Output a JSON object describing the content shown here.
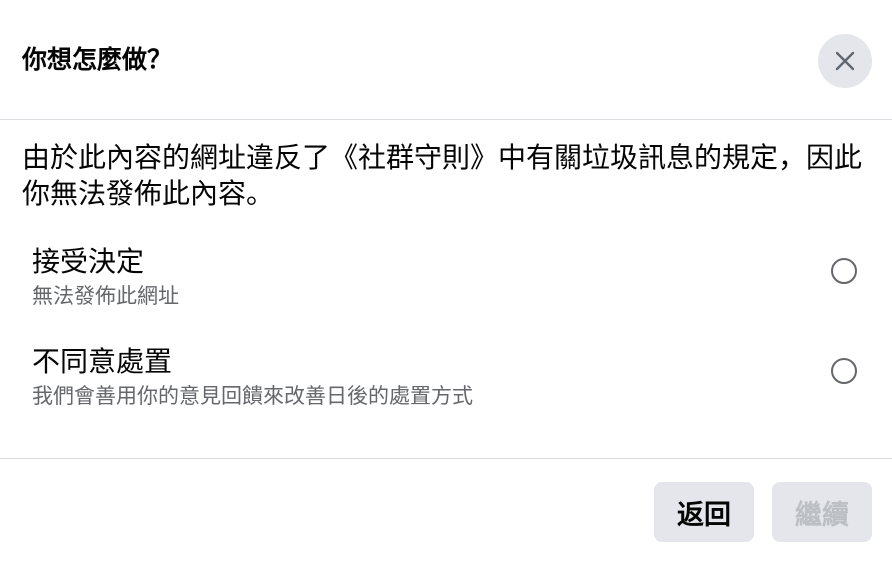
{
  "dialog": {
    "title": "你想怎麼做？",
    "message": "由於此內容的網址違反了《社群守則》中有關垃圾訊息的規定，因此你無法發佈此內容。",
    "options": [
      {
        "title": "接受決定",
        "subtitle": "無法發佈此網址",
        "selected": false
      },
      {
        "title": "不同意處置",
        "subtitle": "我們會善用你的意見回饋來改善日後的處置方式",
        "selected": false
      }
    ],
    "buttons": {
      "back": "返回",
      "continue": "繼續"
    },
    "icons": {
      "close": "close-icon"
    },
    "colors": {
      "button_bg": "#e4e6eb",
      "secondary_text": "#65676b",
      "disabled_text": "#bcc0c4",
      "divider": "#dadde1"
    }
  }
}
